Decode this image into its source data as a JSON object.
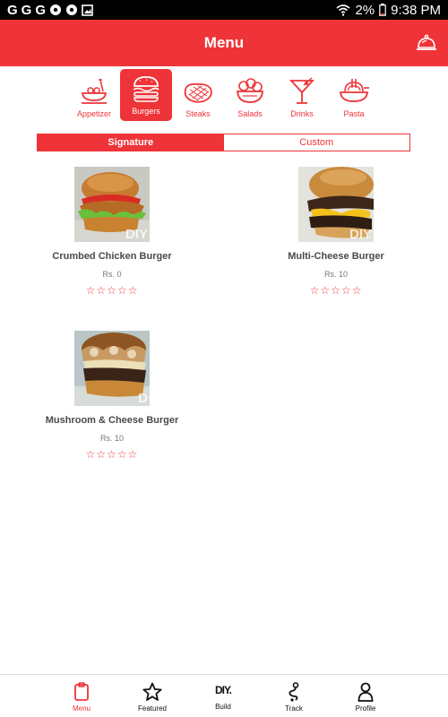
{
  "status_bar": {
    "left_icons": [
      "G",
      "G",
      "G"
    ],
    "battery": "2%",
    "time": "9:38 PM"
  },
  "header": {
    "title": "Menu",
    "right_icon": "cloche-icon"
  },
  "categories": [
    {
      "label": "Appetizer",
      "icon": "appetizer-icon"
    },
    {
      "label": "Burgers",
      "icon": "burger-icon",
      "active": true
    },
    {
      "label": "Steaks",
      "icon": "steak-icon"
    },
    {
      "label": "Salads",
      "icon": "salad-icon"
    },
    {
      "label": "Drinks",
      "icon": "drink-icon"
    },
    {
      "label": "Pasta",
      "icon": "pasta-icon"
    }
  ],
  "tabs": {
    "signature": "Signature",
    "custom": "Custom",
    "selected": "Signature"
  },
  "items": [
    {
      "name": "Crumbed Chicken Burger",
      "price": "Rs. 0",
      "rating": 0,
      "stars": "☆☆☆☆☆",
      "watermark": "DIY"
    },
    {
      "name": "Multi-Cheese Burger",
      "price": "Rs. 10",
      "rating": 0,
      "stars": "☆☆☆☆☆",
      "watermark": "DIY"
    },
    {
      "name": "Mushroom & Cheese Burger",
      "price": "Rs. 10",
      "rating": 0,
      "stars": "☆☆☆☆☆",
      "watermark": "D"
    }
  ],
  "bottom_nav": [
    {
      "label": "Menu",
      "icon": "clipboard-icon",
      "active": true
    },
    {
      "label": "Featured",
      "icon": "star-icon"
    },
    {
      "label": "Build",
      "icon": "diy-icon",
      "icon_text": "DIY."
    },
    {
      "label": "Track",
      "icon": "track-route-icon"
    },
    {
      "label": "Profile",
      "icon": "user-icon"
    }
  ],
  "colors": {
    "accent": "#ee3438"
  }
}
